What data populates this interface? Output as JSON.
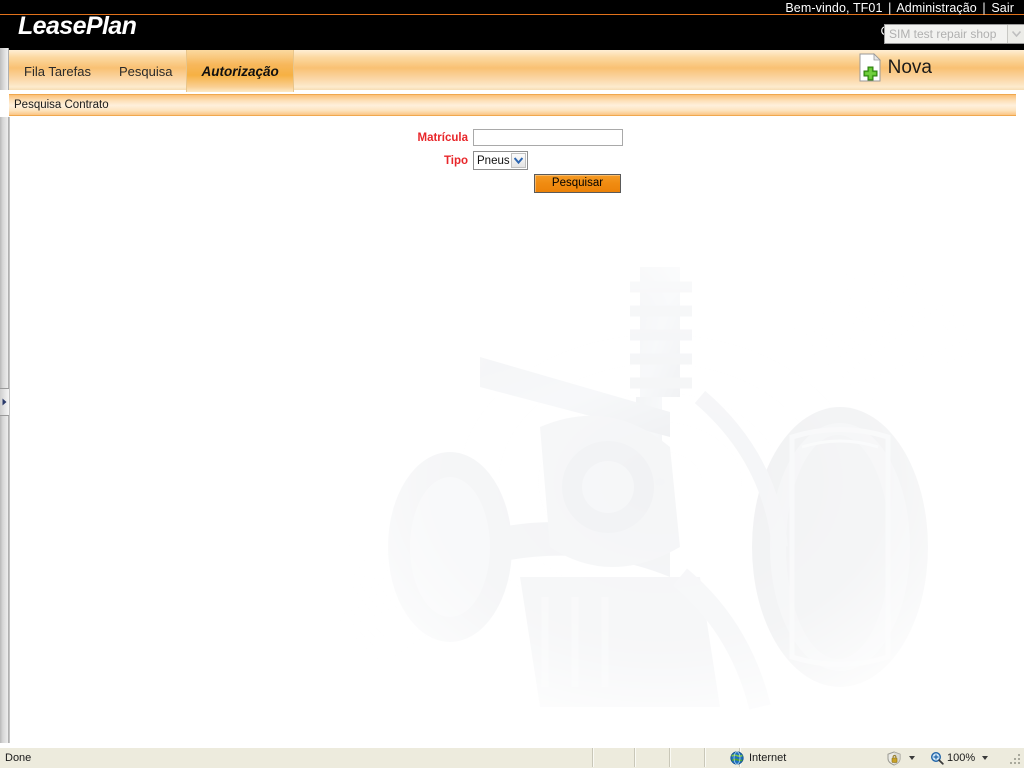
{
  "header": {
    "logo_text": "LeasePlan",
    "welcome_text": "Bem-vindo,",
    "user": "TF01",
    "sep": "|",
    "admin_link": "Administração",
    "logout_link": "Sair",
    "oficina_label": "Oficina",
    "oficina_value": "SIM test repair shop",
    "brand_orange": "#E1721B",
    "bar_background": "#000000"
  },
  "tabs": {
    "items": [
      {
        "label": "Fila Tarefas",
        "active": false
      },
      {
        "label": "Pesquisa",
        "active": false
      },
      {
        "label": "Autorização",
        "active": true
      }
    ],
    "new_button_label": "Nova",
    "new_button_icon": "new-document-icon"
  },
  "subheader": {
    "title": "Pesquisa Contrato"
  },
  "form": {
    "matricula_label": "Matrícula",
    "matricula_value": "",
    "matricula_placeholder": "",
    "tipo_label": "Tipo",
    "tipo_value": "Pneus",
    "tipo_options": [
      "Pneus"
    ],
    "submit_label": "Pesquisar",
    "label_color": "#E8262A",
    "button_color": "#F08B11"
  },
  "statusbar": {
    "status_text": "Done",
    "zone_label": "Internet",
    "zone_icon": "globe-icon",
    "protected_icon": "protected-mode-icon",
    "zoom_icon": "magnifier-icon",
    "zoom_level": "100%"
  }
}
